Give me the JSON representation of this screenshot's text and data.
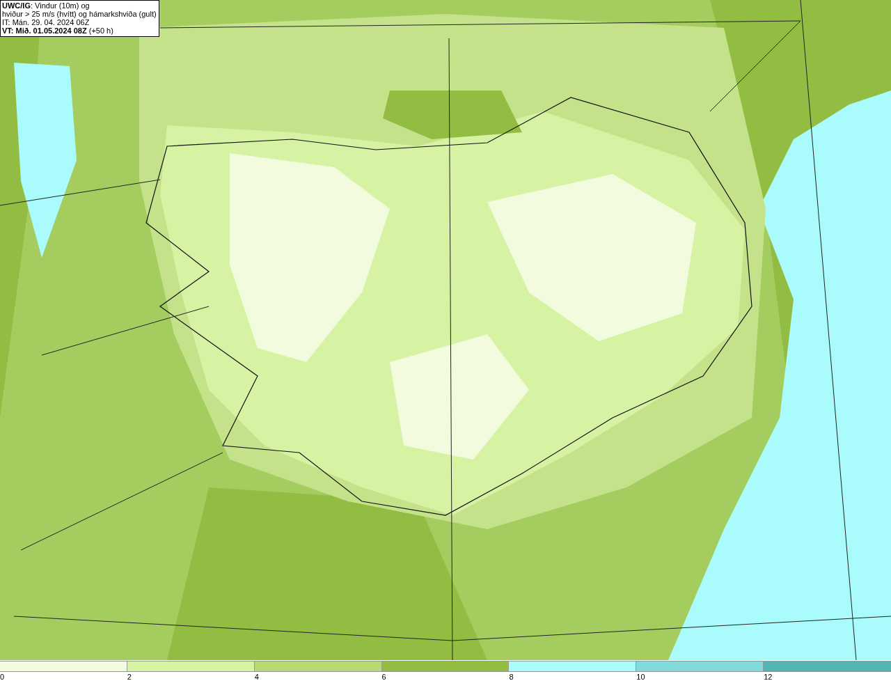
{
  "title_box": {
    "lines": [
      "**UWC/IG**: Vindur (10m) og",
      "hviður > 25 m/s (hvítt) og hámarkshviða (gult)",
      "IT: Mán. 29. 04. 2024 06Z",
      "**VT: Mið. 01.05.2024 08Z** (+50 h)"
    ]
  },
  "legend": {
    "segments": [
      {
        "color": "#f3fbdf"
      },
      {
        "color": "#d6f2a3"
      },
      {
        "color": "#b5d973"
      },
      {
        "color": "#93bd42"
      },
      {
        "color": "#aafcfc"
      },
      {
        "color": "#82dada"
      },
      {
        "color": "#55b4b4"
      }
    ],
    "ticks": [
      "0",
      "2",
      "4",
      "6",
      "8",
      "10",
      "12"
    ]
  }
}
